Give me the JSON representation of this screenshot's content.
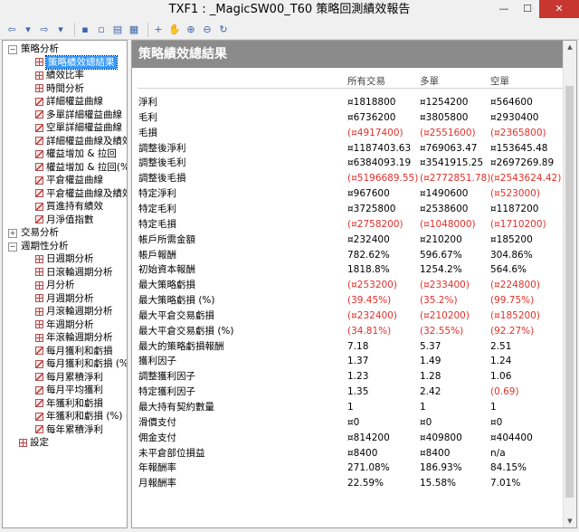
{
  "window": {
    "title": "TXF1 : _MagicSW00_T60 策略回測績效報告",
    "controls": {
      "minimize": "—",
      "maximize": "☐",
      "close": "✕"
    }
  },
  "toolbar": {
    "buttons": [
      {
        "icon": "back-arrow-icon",
        "glyph": "⇦"
      },
      {
        "icon": "dropdown-arrow-icon",
        "glyph": "▾"
      },
      {
        "icon": "forward-arrow-icon",
        "glyph": "⇨"
      },
      {
        "icon": "dropdown-arrow-icon",
        "glyph": "▾"
      },
      {
        "icon": "save-icon",
        "glyph": "▪"
      },
      {
        "icon": "preview-icon",
        "glyph": "▫"
      },
      {
        "icon": "print-icon",
        "glyph": "▤"
      },
      {
        "icon": "window-icon",
        "glyph": "▦"
      },
      {
        "icon": "pointer-icon",
        "glyph": "+"
      },
      {
        "icon": "pan-hand-icon",
        "glyph": "✋"
      },
      {
        "icon": "zoom-in-icon",
        "glyph": "⊕"
      },
      {
        "icon": "zoom-out-icon",
        "glyph": "⊖"
      },
      {
        "icon": "refresh-icon",
        "glyph": "↻"
      }
    ]
  },
  "sidebar": {
    "nodes": [
      {
        "label": "策略分析",
        "level": 0,
        "expander": "−",
        "icon": "none"
      },
      {
        "label": "策略績效總結果",
        "level": 1,
        "icon": "grid",
        "selected": true
      },
      {
        "label": "績效比率",
        "level": 1,
        "icon": "grid"
      },
      {
        "label": "時間分析",
        "level": 1,
        "icon": "grid"
      },
      {
        "label": "詳細權益曲線",
        "level": 1,
        "icon": "chart"
      },
      {
        "label": "多單詳細權益曲線",
        "level": 1,
        "icon": "chart"
      },
      {
        "label": "空單詳細權益曲線",
        "level": 1,
        "icon": "chart"
      },
      {
        "label": "詳細權益曲線及績效",
        "level": 1,
        "icon": "chart"
      },
      {
        "label": "權益增加 & 拉回",
        "level": 1,
        "icon": "chart"
      },
      {
        "label": "權益增加 & 拉回(%)",
        "level": 1,
        "icon": "chart"
      },
      {
        "label": "平倉權益曲線",
        "level": 1,
        "icon": "chart"
      },
      {
        "label": "平倉權益曲線及績效",
        "level": 1,
        "icon": "chart"
      },
      {
        "label": "買進持有績效",
        "level": 1,
        "icon": "chart"
      },
      {
        "label": "月淨值指數",
        "level": 1,
        "icon": "chart"
      },
      {
        "label": "交易分析",
        "level": 0,
        "expander": "+",
        "icon": "none"
      },
      {
        "label": "週期性分析",
        "level": 0,
        "expander": "−",
        "icon": "none"
      },
      {
        "label": "日週期分析",
        "level": 1,
        "icon": "grid"
      },
      {
        "label": "日滾輪週期分析",
        "level": 1,
        "icon": "grid"
      },
      {
        "label": "月分析",
        "level": 1,
        "icon": "grid"
      },
      {
        "label": "月週期分析",
        "level": 1,
        "icon": "grid"
      },
      {
        "label": "月滾輪週期分析",
        "level": 1,
        "icon": "grid"
      },
      {
        "label": "年週期分析",
        "level": 1,
        "icon": "grid"
      },
      {
        "label": "年滾輪週期分析",
        "level": 1,
        "icon": "grid"
      },
      {
        "label": "每月獲利和虧損",
        "level": 1,
        "icon": "chart"
      },
      {
        "label": "每月獲利和虧損 (%)",
        "level": 1,
        "icon": "chart"
      },
      {
        "label": "每月累積淨利",
        "level": 1,
        "icon": "chart"
      },
      {
        "label": "每月平均獲利",
        "level": 1,
        "icon": "chart"
      },
      {
        "label": "年獲利和虧損",
        "level": 1,
        "icon": "chart"
      },
      {
        "label": "年獲利和虧損 (%)",
        "level": 1,
        "icon": "chart"
      },
      {
        "label": "每年累積淨利",
        "level": 1,
        "icon": "chart"
      },
      {
        "label": "設定",
        "level": 0,
        "icon": "grid"
      }
    ]
  },
  "report": {
    "title": "策略績效總結果",
    "columns": [
      "所有交易",
      "多單",
      "空單"
    ],
    "rows": [
      {
        "label": "淨利",
        "values": [
          "¤1818800",
          "¤1254200",
          "¤564600"
        ],
        "neg": [
          false,
          false,
          false
        ]
      },
      {
        "label": "毛利",
        "values": [
          "¤6736200",
          "¤3805800",
          "¤2930400"
        ],
        "neg": [
          false,
          false,
          false
        ]
      },
      {
        "label": "毛損",
        "values": [
          "(¤4917400)",
          "(¤2551600)",
          "(¤2365800)"
        ],
        "neg": [
          true,
          true,
          true
        ]
      },
      {
        "label": "調整後淨利",
        "values": [
          "¤1187403.63",
          "¤769063.47",
          "¤153645.48"
        ],
        "neg": [
          false,
          false,
          false
        ]
      },
      {
        "label": "調整後毛利",
        "values": [
          "¤6384093.19",
          "¤3541915.25",
          "¤2697269.89"
        ],
        "neg": [
          false,
          false,
          false
        ]
      },
      {
        "label": "調整後毛損",
        "values": [
          "(¤5196689.55)",
          "(¤2772851.78)",
          "(¤2543624.42)"
        ],
        "neg": [
          true,
          true,
          true
        ]
      },
      {
        "label": "特定淨利",
        "values": [
          "¤967600",
          "¤1490600",
          "(¤523000)"
        ],
        "neg": [
          false,
          false,
          true
        ]
      },
      {
        "label": "特定毛利",
        "values": [
          "¤3725800",
          "¤2538600",
          "¤1187200"
        ],
        "neg": [
          false,
          false,
          false
        ]
      },
      {
        "label": "特定毛損",
        "values": [
          "(¤2758200)",
          "(¤1048000)",
          "(¤1710200)"
        ],
        "neg": [
          true,
          true,
          true
        ]
      },
      {
        "label": "帳戶所需金額",
        "values": [
          "¤232400",
          "¤210200",
          "¤185200"
        ],
        "neg": [
          false,
          false,
          false
        ]
      },
      {
        "label": "帳戶報酬",
        "values": [
          "782.62%",
          "596.67%",
          "304.86%"
        ],
        "neg": [
          false,
          false,
          false
        ]
      },
      {
        "label": "初始資本報酬",
        "values": [
          "1818.8%",
          "1254.2%",
          "564.6%"
        ],
        "neg": [
          false,
          false,
          false
        ]
      },
      {
        "label": "最大策略虧損",
        "values": [
          "(¤253200)",
          "(¤233400)",
          "(¤224800)"
        ],
        "neg": [
          true,
          true,
          true
        ]
      },
      {
        "label": "最大策略虧損 (%)",
        "values": [
          "(39.45%)",
          "(35.2%)",
          "(99.75%)"
        ],
        "neg": [
          true,
          true,
          true
        ]
      },
      {
        "label": "最大平倉交易虧損",
        "values": [
          "(¤232400)",
          "(¤210200)",
          "(¤185200)"
        ],
        "neg": [
          true,
          true,
          true
        ]
      },
      {
        "label": "最大平倉交易虧損 (%)",
        "values": [
          "(34.81%)",
          "(32.55%)",
          "(92.27%)"
        ],
        "neg": [
          true,
          true,
          true
        ]
      },
      {
        "label": "最大的策略虧損報酬",
        "values": [
          "7.18",
          "5.37",
          "2.51"
        ],
        "neg": [
          false,
          false,
          false
        ]
      },
      {
        "label": "獲利因子",
        "values": [
          "1.37",
          "1.49",
          "1.24"
        ],
        "neg": [
          false,
          false,
          false
        ]
      },
      {
        "label": "調整獲利因子",
        "values": [
          "1.23",
          "1.28",
          "1.06"
        ],
        "neg": [
          false,
          false,
          false
        ]
      },
      {
        "label": "特定獲利因子",
        "values": [
          "1.35",
          "2.42",
          "(0.69)"
        ],
        "neg": [
          false,
          false,
          true
        ]
      },
      {
        "label": "最大持有契約數量",
        "values": [
          "1",
          "1",
          "1"
        ],
        "neg": [
          false,
          false,
          false
        ]
      },
      {
        "label": "滑價支付",
        "values": [
          "¤0",
          "¤0",
          "¤0"
        ],
        "neg": [
          false,
          false,
          false
        ]
      },
      {
        "label": "佣金支付",
        "values": [
          "¤814200",
          "¤409800",
          "¤404400"
        ],
        "neg": [
          false,
          false,
          false
        ]
      },
      {
        "label": "未平倉部位損益",
        "values": [
          "¤8400",
          "¤8400",
          "n/a"
        ],
        "neg": [
          false,
          false,
          false
        ]
      },
      {
        "label": "年報酬率",
        "values": [
          "271.08%",
          "186.93%",
          "84.15%"
        ],
        "neg": [
          false,
          false,
          false
        ]
      },
      {
        "label": "月報酬率",
        "values": [
          "22.59%",
          "15.58%",
          "7.01%"
        ],
        "neg": [
          false,
          false,
          false
        ]
      }
    ]
  },
  "colors": {
    "negative": "#e0312b",
    "header_band": "#8b8b8b",
    "selection": "#3399ff",
    "close_button": "#c7372f"
  }
}
